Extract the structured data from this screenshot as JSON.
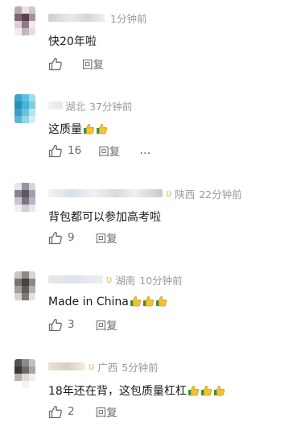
{
  "comments": [
    {
      "location": "",
      "time": "1分钟前",
      "text": "快20年啦",
      "emojis": 0,
      "likes": "",
      "reply_label": "回复",
      "show_more": false
    },
    {
      "location": "湖北",
      "time": "37分钟前",
      "text": "这质量",
      "emojis": 2,
      "likes": "16",
      "reply_label": "回复",
      "show_more": true,
      "more_label": "…"
    },
    {
      "location": "陕西",
      "time": "22分钟前",
      "text": "背包都可以参加高考啦",
      "emojis": 0,
      "likes": "9",
      "reply_label": "回复",
      "show_more": false
    },
    {
      "location": "湖南",
      "time": "10分钟前",
      "text": "Made in China",
      "emojis": 3,
      "likes": "3",
      "reply_label": "回复",
      "show_more": false
    },
    {
      "location": "广西",
      "time": "5分钟前",
      "text": "18年还在背，这包质量杠杠",
      "emojis": 3,
      "likes": "2",
      "reply_label": "回复",
      "show_more": false
    }
  ],
  "icons": {
    "like": "thumbs-up-outline-icon",
    "emoji": "thumbs-up-emoji-icon",
    "vip": "vip-badge-icon"
  },
  "colors": {
    "meta": "#9a9a9a",
    "text": "#1a1a1a",
    "action": "#6b6b6b",
    "vip": "#e8b84a"
  }
}
